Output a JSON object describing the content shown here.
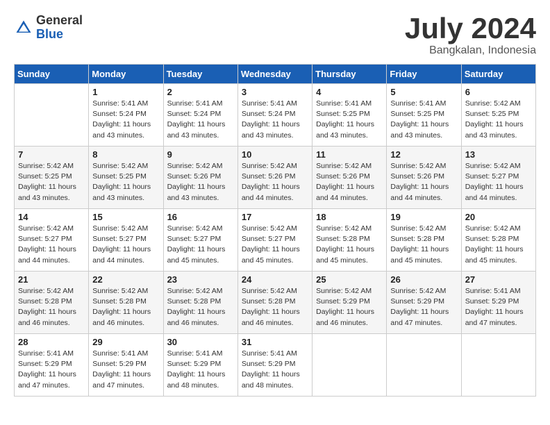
{
  "logo": {
    "general": "General",
    "blue": "Blue"
  },
  "header": {
    "month": "July 2024",
    "location": "Bangkalan, Indonesia"
  },
  "weekdays": [
    "Sunday",
    "Monday",
    "Tuesday",
    "Wednesday",
    "Thursday",
    "Friday",
    "Saturday"
  ],
  "weeks": [
    [
      {
        "day": "",
        "info": ""
      },
      {
        "day": "1",
        "info": "Sunrise: 5:41 AM\nSunset: 5:24 PM\nDaylight: 11 hours\nand 43 minutes."
      },
      {
        "day": "2",
        "info": "Sunrise: 5:41 AM\nSunset: 5:24 PM\nDaylight: 11 hours\nand 43 minutes."
      },
      {
        "day": "3",
        "info": "Sunrise: 5:41 AM\nSunset: 5:24 PM\nDaylight: 11 hours\nand 43 minutes."
      },
      {
        "day": "4",
        "info": "Sunrise: 5:41 AM\nSunset: 5:25 PM\nDaylight: 11 hours\nand 43 minutes."
      },
      {
        "day": "5",
        "info": "Sunrise: 5:41 AM\nSunset: 5:25 PM\nDaylight: 11 hours\nand 43 minutes."
      },
      {
        "day": "6",
        "info": "Sunrise: 5:42 AM\nSunset: 5:25 PM\nDaylight: 11 hours\nand 43 minutes."
      }
    ],
    [
      {
        "day": "7",
        "info": "Sunrise: 5:42 AM\nSunset: 5:25 PM\nDaylight: 11 hours\nand 43 minutes."
      },
      {
        "day": "8",
        "info": "Sunrise: 5:42 AM\nSunset: 5:25 PM\nDaylight: 11 hours\nand 43 minutes."
      },
      {
        "day": "9",
        "info": "Sunrise: 5:42 AM\nSunset: 5:26 PM\nDaylight: 11 hours\nand 43 minutes."
      },
      {
        "day": "10",
        "info": "Sunrise: 5:42 AM\nSunset: 5:26 PM\nDaylight: 11 hours\nand 44 minutes."
      },
      {
        "day": "11",
        "info": "Sunrise: 5:42 AM\nSunset: 5:26 PM\nDaylight: 11 hours\nand 44 minutes."
      },
      {
        "day": "12",
        "info": "Sunrise: 5:42 AM\nSunset: 5:26 PM\nDaylight: 11 hours\nand 44 minutes."
      },
      {
        "day": "13",
        "info": "Sunrise: 5:42 AM\nSunset: 5:27 PM\nDaylight: 11 hours\nand 44 minutes."
      }
    ],
    [
      {
        "day": "14",
        "info": "Sunrise: 5:42 AM\nSunset: 5:27 PM\nDaylight: 11 hours\nand 44 minutes."
      },
      {
        "day": "15",
        "info": "Sunrise: 5:42 AM\nSunset: 5:27 PM\nDaylight: 11 hours\nand 44 minutes."
      },
      {
        "day": "16",
        "info": "Sunrise: 5:42 AM\nSunset: 5:27 PM\nDaylight: 11 hours\nand 45 minutes."
      },
      {
        "day": "17",
        "info": "Sunrise: 5:42 AM\nSunset: 5:27 PM\nDaylight: 11 hours\nand 45 minutes."
      },
      {
        "day": "18",
        "info": "Sunrise: 5:42 AM\nSunset: 5:28 PM\nDaylight: 11 hours\nand 45 minutes."
      },
      {
        "day": "19",
        "info": "Sunrise: 5:42 AM\nSunset: 5:28 PM\nDaylight: 11 hours\nand 45 minutes."
      },
      {
        "day": "20",
        "info": "Sunrise: 5:42 AM\nSunset: 5:28 PM\nDaylight: 11 hours\nand 45 minutes."
      }
    ],
    [
      {
        "day": "21",
        "info": "Sunrise: 5:42 AM\nSunset: 5:28 PM\nDaylight: 11 hours\nand 46 minutes."
      },
      {
        "day": "22",
        "info": "Sunrise: 5:42 AM\nSunset: 5:28 PM\nDaylight: 11 hours\nand 46 minutes."
      },
      {
        "day": "23",
        "info": "Sunrise: 5:42 AM\nSunset: 5:28 PM\nDaylight: 11 hours\nand 46 minutes."
      },
      {
        "day": "24",
        "info": "Sunrise: 5:42 AM\nSunset: 5:28 PM\nDaylight: 11 hours\nand 46 minutes."
      },
      {
        "day": "25",
        "info": "Sunrise: 5:42 AM\nSunset: 5:29 PM\nDaylight: 11 hours\nand 46 minutes."
      },
      {
        "day": "26",
        "info": "Sunrise: 5:42 AM\nSunset: 5:29 PM\nDaylight: 11 hours\nand 47 minutes."
      },
      {
        "day": "27",
        "info": "Sunrise: 5:41 AM\nSunset: 5:29 PM\nDaylight: 11 hours\nand 47 minutes."
      }
    ],
    [
      {
        "day": "28",
        "info": "Sunrise: 5:41 AM\nSunset: 5:29 PM\nDaylight: 11 hours\nand 47 minutes."
      },
      {
        "day": "29",
        "info": "Sunrise: 5:41 AM\nSunset: 5:29 PM\nDaylight: 11 hours\nand 47 minutes."
      },
      {
        "day": "30",
        "info": "Sunrise: 5:41 AM\nSunset: 5:29 PM\nDaylight: 11 hours\nand 48 minutes."
      },
      {
        "day": "31",
        "info": "Sunrise: 5:41 AM\nSunset: 5:29 PM\nDaylight: 11 hours\nand 48 minutes."
      },
      {
        "day": "",
        "info": ""
      },
      {
        "day": "",
        "info": ""
      },
      {
        "day": "",
        "info": ""
      }
    ]
  ]
}
